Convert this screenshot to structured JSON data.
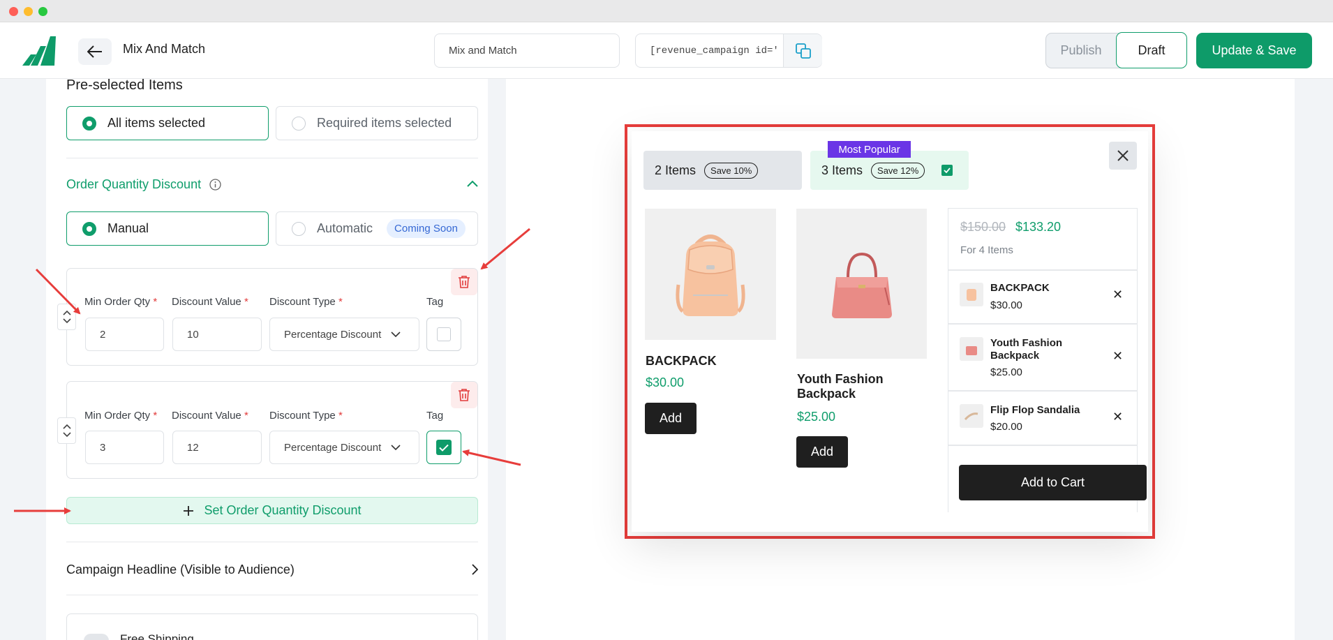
{
  "header": {
    "page_title": "Mix And Match",
    "campaign_name_value": "Mix and Match",
    "shortcode_value": "[revenue_campaign id='",
    "publish_label": "Publish",
    "draft_label": "Draft",
    "update_label": "Update & Save"
  },
  "left": {
    "preselected_title": "Pre-selected Items",
    "preselected_options": [
      "All items selected",
      "Required items selected"
    ],
    "oqd_title": "Order Quantity Discount",
    "oqd_modes": [
      "Manual",
      "Automatic"
    ],
    "coming_soon": "Coming Soon",
    "field_labels": {
      "min_qty": "Min Order Qty",
      "discount_value": "Discount Value",
      "discount_type": "Discount Type",
      "tag": "Tag",
      "required_mark": "*"
    },
    "tiers": [
      {
        "min_qty": "2",
        "discount_value": "10",
        "discount_type": "Percentage Discount",
        "tag": false
      },
      {
        "min_qty": "3",
        "discount_value": "12",
        "discount_type": "Percentage Discount",
        "tag": true
      }
    ],
    "add_tier_label": "Set Order Quantity Discount",
    "headline_label": "Campaign Headline (Visible to Audience)",
    "free_shipping_label": "Free Shipping"
  },
  "preview": {
    "tiers": [
      {
        "label": "2 Items",
        "save": "Save 10%",
        "selected": false
      },
      {
        "label": "3 Items",
        "save": "Save 12%",
        "selected": true,
        "badge": "Most Popular"
      }
    ],
    "products": [
      {
        "name": "BACKPACK",
        "price": "$30.00",
        "add": "Add"
      },
      {
        "name": "Youth Fashion Backpack",
        "price": "$25.00",
        "add": "Add"
      }
    ],
    "summary": {
      "old_price": "$150.00",
      "new_price": "$133.20",
      "count_text": "For 4 Items",
      "items": [
        {
          "name": "BACKPACK",
          "price": "$30.00"
        },
        {
          "name": "Youth Fashion Backpack",
          "price": "$25.00"
        },
        {
          "name": "Flip Flop Sandalia",
          "price": "$20.00"
        }
      ],
      "cart_button": "Add to Cart"
    }
  },
  "colors": {
    "brand_green": "#0e9b69",
    "annotation_red": "#e73d3b",
    "badge_purple": "#6a35e6"
  }
}
